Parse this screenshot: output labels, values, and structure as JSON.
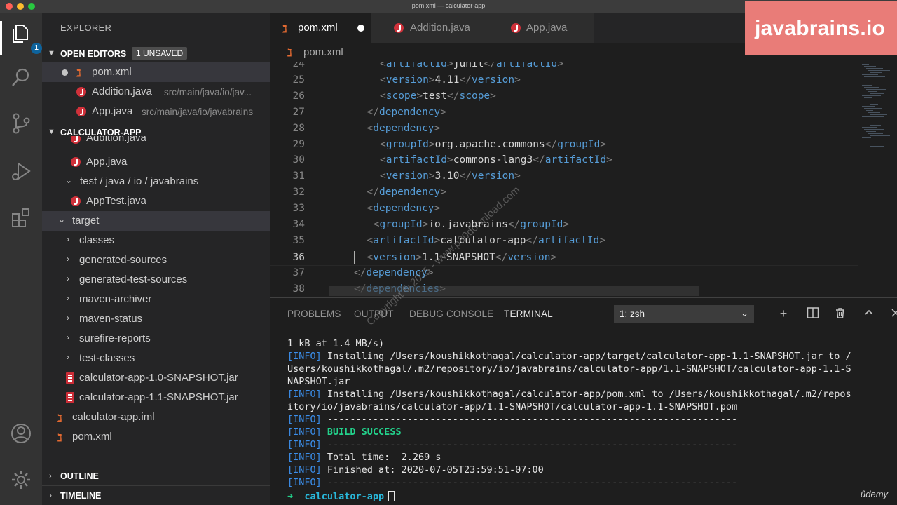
{
  "window": {
    "title": "pom.xml — calculator-app"
  },
  "activity_bar": {
    "items": [
      "explorer-icon",
      "search-icon",
      "source-control-icon",
      "run-debug-icon",
      "extensions-icon"
    ],
    "explorer_badge": "1",
    "bottom_items": [
      "account-icon",
      "settings-gear-icon"
    ]
  },
  "sidebar": {
    "title": "EXPLORER",
    "open_editors": {
      "label": "OPEN EDITORS",
      "badge": "1 UNSAVED",
      "items": [
        {
          "name": "pom.xml",
          "desc": ""
        },
        {
          "name": "Addition.java",
          "desc": "src/main/java/io/jav..."
        },
        {
          "name": "App.java",
          "desc": "src/main/java/io/javabrains"
        }
      ]
    },
    "project": {
      "label": "CALCULATOR-APP",
      "tree": [
        "Addition.java",
        "App.java",
        "test / java / io / javabrains",
        "AppTest.java",
        "target",
        "classes",
        "generated-sources",
        "generated-test-sources",
        "maven-archiver",
        "maven-status",
        "surefire-reports",
        "test-classes",
        "calculator-app-1.0-SNAPSHOT.jar",
        "calculator-app-1.1-SNAPSHOT.jar",
        "calculator-app.iml",
        "pom.xml"
      ]
    },
    "outline_label": "OUTLINE",
    "timeline_label": "TIMELINE"
  },
  "tabs": [
    {
      "label": "pom.xml",
      "active": true,
      "modified": true
    },
    {
      "label": "Addition.java",
      "active": false
    },
    {
      "label": "App.java",
      "active": false
    }
  ],
  "breadcrumb": "pom.xml",
  "brand": "javabrains.io",
  "editor": {
    "current_line": 36,
    "lines": [
      {
        "n": "24",
        "indent": 2,
        "tag": "artifactId",
        "text": "junit"
      },
      {
        "n": "25",
        "indent": 2,
        "tag": "version",
        "text": "4.11"
      },
      {
        "n": "26",
        "indent": 2,
        "tag": "scope",
        "text": "test"
      },
      {
        "n": "27",
        "indent": 1,
        "close": "dependency"
      },
      {
        "n": "28",
        "indent": 1,
        "open": "dependency"
      },
      {
        "n": "29",
        "indent": 2,
        "tag": "groupId",
        "text": "org.apache.commons"
      },
      {
        "n": "30",
        "indent": 2,
        "tag": "artifactId",
        "text": "commons-lang3"
      },
      {
        "n": "31",
        "indent": 2,
        "tag": "version",
        "text": "3.10"
      },
      {
        "n": "32",
        "indent": 1,
        "close": "dependency"
      },
      {
        "n": "33",
        "indent": 1,
        "open": "dependency"
      },
      {
        "n": "34",
        "indent": 1.5,
        "tag": "groupId",
        "text": "io.javabrains"
      },
      {
        "n": "35",
        "indent": 1,
        "tag": "artifactId",
        "text": "calculator-app"
      },
      {
        "n": "36",
        "indent": 1,
        "tag": "version",
        "text": "1.1-SNAPSHOT"
      },
      {
        "n": "37",
        "indent": 0,
        "close": "dependency"
      },
      {
        "n": "38",
        "indent": 0,
        "close": "dependencies"
      }
    ]
  },
  "panel": {
    "tabs": [
      "PROBLEMS",
      "OUTPUT",
      "DEBUG CONSOLE",
      "TERMINAL"
    ],
    "active_tab": "TERMINAL",
    "terminal_select": "1: zsh",
    "actions": [
      "add-terminal-icon",
      "split-terminal-icon",
      "trash-icon",
      "maximize-panel-icon",
      "close-panel-icon"
    ]
  },
  "terminal": {
    "lines": [
      {
        "prefix": "",
        "text": "1 kB at 1.4 MB/s)"
      },
      {
        "prefix": "[INFO]",
        "text": " Installing /Users/koushikkothagal/calculator-app/target/calculator-app-1.1-SNAPSHOT.jar to /"
      },
      {
        "prefix": "",
        "text": "Users/koushikkothagal/.m2/repository/io/javabrains/calculator-app/1.1-SNAPSHOT/calculator-app-1.1-S"
      },
      {
        "prefix": "",
        "text": "NAPSHOT.jar"
      },
      {
        "prefix": "[INFO]",
        "text": " Installing /Users/koushikkothagal/calculator-app/pom.xml to /Users/koushikkothagal/.m2/repos"
      },
      {
        "prefix": "",
        "text": "itory/io/javabrains/calculator-app/1.1-SNAPSHOT/calculator-app-1.1-SNAPSHOT.pom"
      },
      {
        "prefix": "[INFO]",
        "text": " ------------------------------------------------------------------------"
      },
      {
        "prefix": "[INFO]",
        "text": " BUILD SUCCESS",
        "success": true
      },
      {
        "prefix": "[INFO]",
        "text": " ------------------------------------------------------------------------"
      },
      {
        "prefix": "[INFO]",
        "text": " Total time:  2.269 s"
      },
      {
        "prefix": "[INFO]",
        "text": " Finished at: 2020-07-05T23:59:51-07:00"
      },
      {
        "prefix": "[INFO]",
        "text": " ------------------------------------------------------------------------"
      }
    ],
    "prompt_symbol": "➜",
    "prompt_dir": "calculator-app"
  },
  "watermark": "Copyright © 2025 - www.p30download.com",
  "udemy": "ûdemy"
}
